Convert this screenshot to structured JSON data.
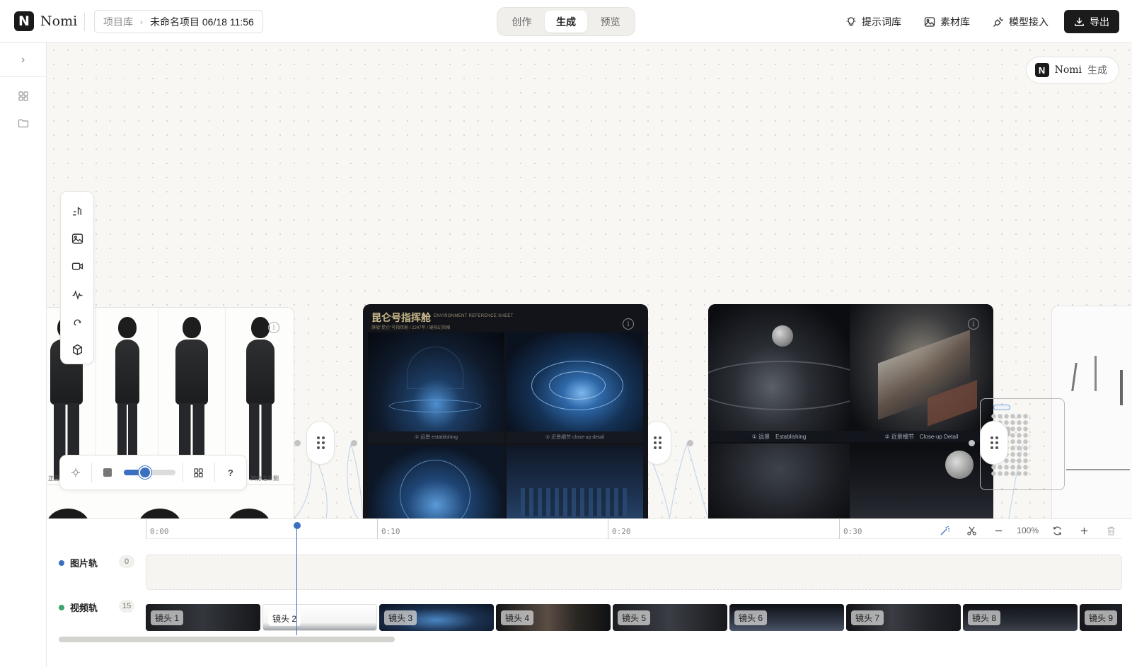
{
  "header": {
    "logo_text": "Nomi",
    "logo_mark": "N",
    "breadcrumb": {
      "library": "项目库",
      "separator": "›",
      "current": "未命名项目 06/18 11:56"
    },
    "modes": [
      {
        "label": "创作",
        "active": false
      },
      {
        "label": "生成",
        "active": true
      },
      {
        "label": "预览",
        "active": false
      }
    ],
    "actions": [
      {
        "label": "提示词库",
        "icon": "lightbulb-icon"
      },
      {
        "label": "素材库",
        "icon": "image-icon"
      },
      {
        "label": "模型接入",
        "icon": "plug-icon"
      }
    ],
    "export_label": "导出"
  },
  "sidebar": {
    "toggle": "›",
    "icons": [
      "grid-icon",
      "folder-icon"
    ]
  },
  "canvas": {
    "nomi_chip": {
      "brand": "Nomi",
      "label": "生成"
    },
    "tools": [
      "text-tool-icon",
      "image-tool-icon",
      "video-tool-icon",
      "audio-tool-icon",
      "link-tool-icon",
      "3d-cube-icon"
    ],
    "character_card": {
      "labels": [
        "正面全",
        "四分之三侧"
      ]
    },
    "mini_controls": {
      "zoom_level": 0.42,
      "help": "?"
    },
    "environment_card": {
      "title": "昆仑号指挥舱",
      "subtitle_en": "ENVIRONMENT REFERENCE SHEET",
      "subtitle": "旗舰\"昆仑\"号指挥舱 / 2247年 / 硬核幻风格",
      "captions": [
        "① 远景 establishing",
        "② 近景细节 close-up detail"
      ]
    },
    "space_card": {
      "captions": [
        "① 远景　Establishing",
        "② 近景细节　Close-up Detail"
      ]
    }
  },
  "timeline": {
    "ticks": [
      "0:00",
      "0:10",
      "0:20",
      "0:30"
    ],
    "zoom_text": "100%",
    "playhead_seconds": 6.5,
    "tracks": [
      {
        "label": "图片轨",
        "count": "0",
        "color": "#3b6fc0"
      },
      {
        "label": "视频轨",
        "count": "15",
        "color": "#3aa66e"
      }
    ],
    "clips": [
      "镜头 1",
      "镜头 2",
      "镜头 3",
      "镜头 4",
      "镜头 5",
      "镜头 6",
      "镜头 7",
      "镜头 8",
      "镜头 9"
    ]
  }
}
